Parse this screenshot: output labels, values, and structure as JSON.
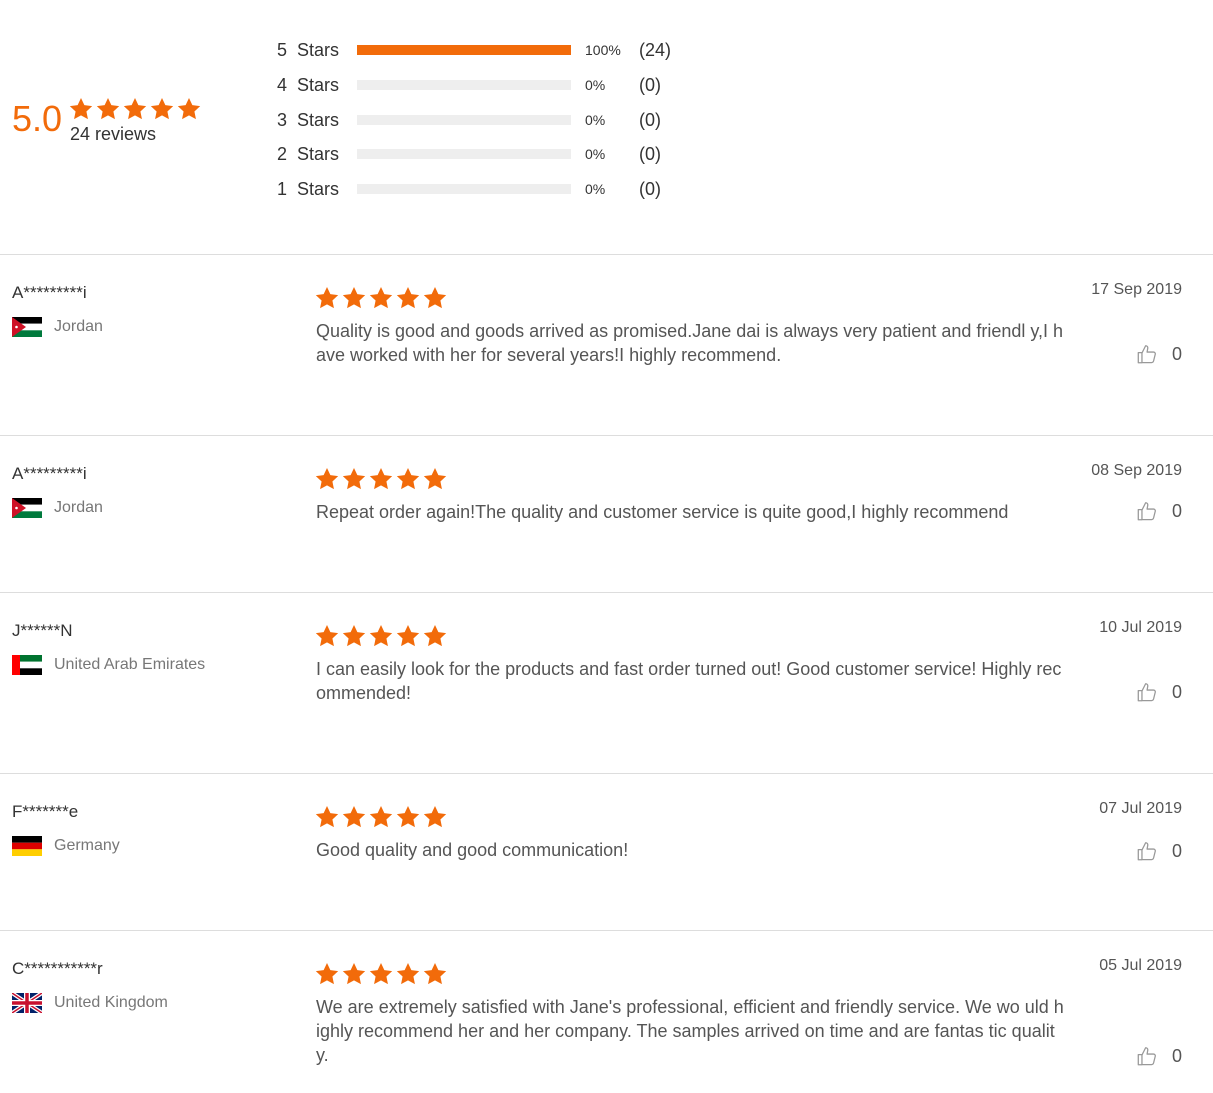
{
  "summary": {
    "average": "5.0",
    "average_stars": 5,
    "review_count": "24 reviews",
    "accent_color": "#f26b0a",
    "distribution": [
      {
        "label": "5  Stars",
        "fraction": 1.0,
        "percent": "100%",
        "count": "(24)"
      },
      {
        "label": "4  Stars",
        "fraction": 0.0,
        "percent": "0%",
        "count": "(0)"
      },
      {
        "label": "3  Stars",
        "fraction": 0.0,
        "percent": "0%",
        "count": "(0)"
      },
      {
        "label": "2  Stars",
        "fraction": 0.0,
        "percent": "0%",
        "count": "(0)"
      },
      {
        "label": "1  Stars",
        "fraction": 0.0,
        "percent": "0%",
        "count": "(0)"
      }
    ]
  },
  "reviews": [
    {
      "name": "A*********i",
      "country": "Jordan",
      "flag_icon": "jordan-flag-icon",
      "stars": 5,
      "text": "Quality is good and goods arrived as promised.Jane dai is always very patient and friendl y,I have worked with her for several years!I highly recommend.",
      "date": "17 Sep 2019",
      "likes": "0"
    },
    {
      "name": "A*********i",
      "country": "Jordan",
      "flag_icon": "jordan-flag-icon",
      "stars": 5,
      "text": "Repeat order again!The quality and customer service is quite good,I highly recommend",
      "date": "08 Sep 2019",
      "likes": "0"
    },
    {
      "name": "J******N",
      "country": "United Arab Emirates",
      "flag_icon": "uae-flag-icon",
      "stars": 5,
      "text": "I can easily look for the products and fast order turned out! Good customer service! Highly recommended!",
      "date": "10 Jul 2019",
      "likes": "0"
    },
    {
      "name": "F*******e",
      "country": "Germany",
      "flag_icon": "germany-flag-icon",
      "stars": 5,
      "text": "Good quality and good communication!",
      "date": "07 Jul 2019",
      "likes": "0"
    },
    {
      "name": "C***********r",
      "country": "United Kingdom",
      "flag_icon": "uk-flag-icon",
      "stars": 5,
      "text": "We are extremely satisfied with Jane's professional, efficient and friendly service. We wo uld highly recommend her and her company.  The samples arrived on time and are fantas tic quality.",
      "date": "05 Jul 2019",
      "likes": "0"
    }
  ]
}
